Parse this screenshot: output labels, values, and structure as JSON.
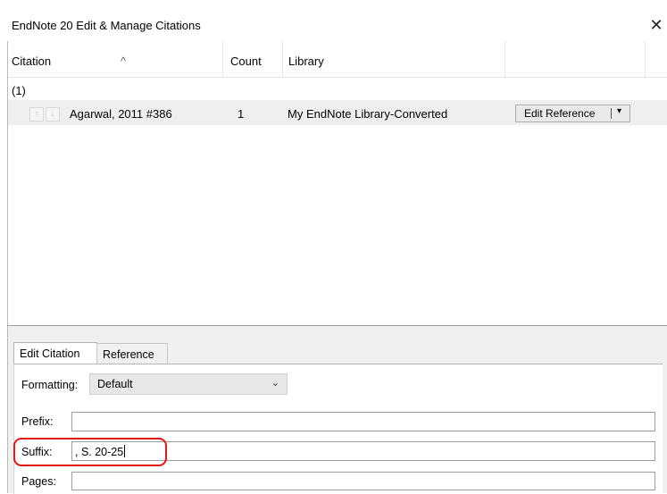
{
  "window": {
    "title": "EndNote 20 Edit & Manage Citations",
    "close_glyph": "✕"
  },
  "table": {
    "columns": [
      {
        "label": "Citation"
      },
      {
        "label": "Count"
      },
      {
        "label": "Library"
      }
    ],
    "sort_glyph": "^",
    "group_label": "(1)",
    "rows": [
      {
        "up_glyph": "↑",
        "down_glyph": "↓",
        "citation": "Agarwal, 2011 #386",
        "count": "1",
        "library": "My EndNote Library-Converted",
        "action_label": "Edit Reference",
        "dropdown_glyph": "▾"
      }
    ]
  },
  "tabs": [
    {
      "label": "Edit Citation",
      "active": true
    },
    {
      "label": "Reference",
      "active": false
    }
  ],
  "form": {
    "formatting_label": "Formatting:",
    "formatting_value": "Default",
    "chevron_glyph": "⌄",
    "prefix_label": "Prefix:",
    "prefix_value": "",
    "suffix_label": "Suffix:",
    "suffix_value": ", S. 20-25",
    "pages_label": "Pages:",
    "pages_value": ""
  },
  "colors": {
    "highlight_ring": "#e11616",
    "row_background": "#efefef",
    "panel_background": "#f0f0f0"
  }
}
